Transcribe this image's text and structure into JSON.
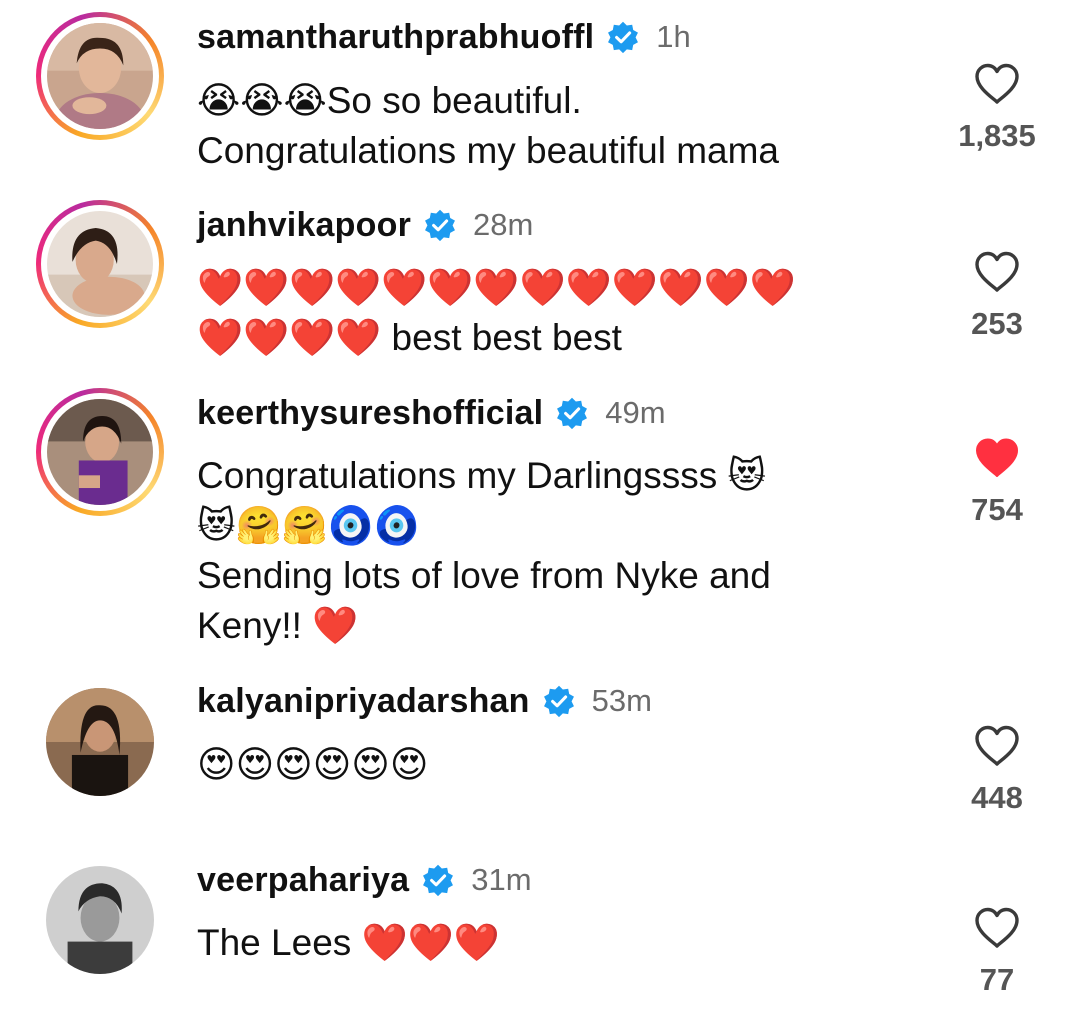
{
  "colors": {
    "verified": "#1d9bf0",
    "liked": "#ff3040",
    "muted": "#6b6b6b"
  },
  "comments": [
    {
      "username": "samantharuthprabhuoffl",
      "verified": true,
      "time": "1h",
      "text": "😭😭😭So so beautiful.\nCongratulations my beautiful mama",
      "likes": "1,835",
      "liked": false,
      "story_ring": true
    },
    {
      "username": "janhvikapoor",
      "verified": true,
      "time": "28m",
      "text": "❤️❤️❤️❤️❤️❤️❤️❤️❤️❤️❤️❤️❤️\n❤️❤️❤️❤️ best best best",
      "likes": "253",
      "liked": false,
      "story_ring": true
    },
    {
      "username": "keerthysureshofficial",
      "verified": true,
      "time": "49m",
      "text": "Congratulations my Darlingssss 😻\n😻🤗🤗🧿🧿\nSending lots of love from Nyke and\nKeny!! ❤️",
      "likes": "754",
      "liked": true,
      "story_ring": true
    },
    {
      "username": "kalyanipriyadarshan",
      "verified": true,
      "time": "53m",
      "text": "😍😍😍😍😍😍",
      "likes": "448",
      "liked": false,
      "story_ring": false
    },
    {
      "username": "veerpahariya",
      "verified": true,
      "time": "31m",
      "text": "The Lees ❤️❤️❤️",
      "likes": "77",
      "liked": false,
      "story_ring": false
    }
  ]
}
